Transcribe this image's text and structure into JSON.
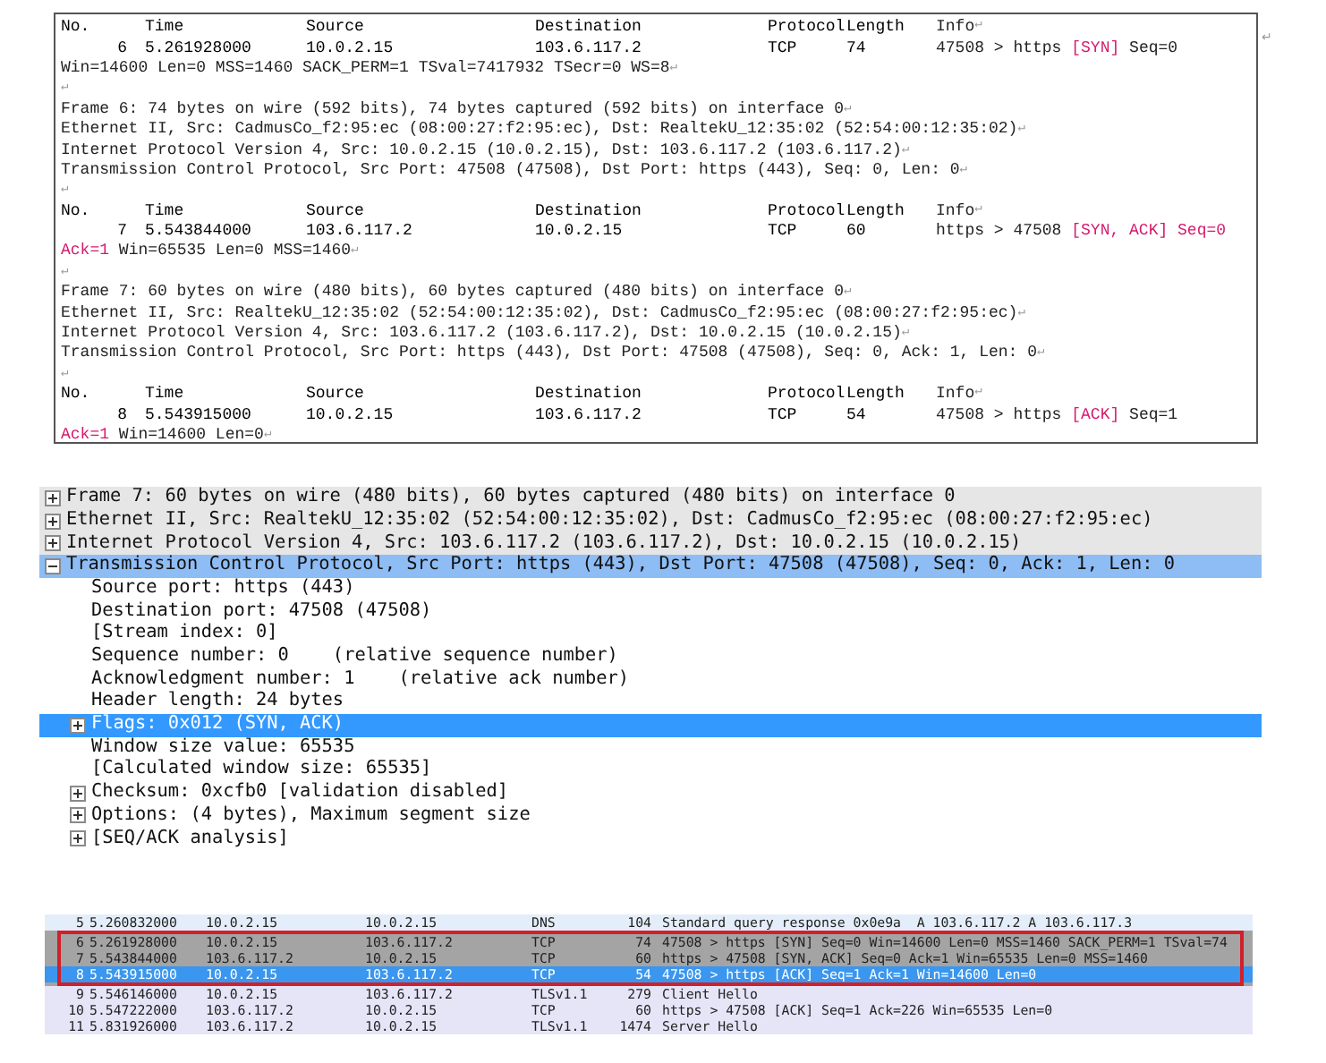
{
  "document": {
    "lines": [
      {
        "kind": "header",
        "cells": [
          "No.",
          "Time",
          "Source",
          "Destination",
          "Protocol",
          "Length"
        ],
        "info": [
          {
            "text": "Info",
            "kind": "plain"
          },
          {
            "text": "↵",
            "kind": "mark"
          }
        ]
      },
      {
        "kind": "packet",
        "cells": [
          "6",
          "5.261928000",
          "10.0.2.15",
          "103.6.117.2",
          "TCP",
          "74"
        ],
        "info": [
          {
            "text": "47508 > https ",
            "kind": "plain"
          },
          {
            "text": "[SYN]",
            "kind": "flag"
          },
          {
            "text": " Seq=0",
            "kind": "plain"
          }
        ]
      },
      {
        "kind": "text",
        "segments": [
          {
            "text": "Win=14600 Len=0 MSS=1460 SACK_PERM=1 TSval=7417932 TSecr=0 WS=8",
            "kind": "plain"
          },
          {
            "text": "↵",
            "kind": "mark"
          }
        ]
      },
      {
        "kind": "text",
        "segments": [
          {
            "text": "↵",
            "kind": "mark"
          }
        ]
      },
      {
        "kind": "text",
        "segments": [
          {
            "text": "Frame 6: 74 bytes on wire (592 bits), 74 bytes captured (592 bits) on interface 0",
            "kind": "plain"
          },
          {
            "text": "↵",
            "kind": "mark"
          }
        ]
      },
      {
        "kind": "text",
        "segments": [
          {
            "text": "Ethernet II, Src: CadmusCo_f2:95:ec (08:00:27:f2:95:ec), Dst: RealtekU_12:35:02 (52:54:00:12:35:02)",
            "kind": "plain"
          },
          {
            "text": "↵",
            "kind": "mark"
          }
        ]
      },
      {
        "kind": "text",
        "segments": [
          {
            "text": "Internet Protocol Version 4, Src: 10.0.2.15 (10.0.2.15), Dst: 103.6.117.2 (103.6.117.2)",
            "kind": "plain"
          },
          {
            "text": "↵",
            "kind": "mark"
          }
        ]
      },
      {
        "kind": "text",
        "segments": [
          {
            "text": "Transmission Control Protocol, Src Port: 47508 (47508), Dst Port: https (443), Seq: 0, Len: 0",
            "kind": "plain"
          },
          {
            "text": "↵",
            "kind": "mark"
          }
        ]
      },
      {
        "kind": "text",
        "segments": [
          {
            "text": "↵",
            "kind": "mark"
          }
        ]
      },
      {
        "kind": "header",
        "cells": [
          "No.",
          "Time",
          "Source",
          "Destination",
          "Protocol",
          "Length"
        ],
        "info": [
          {
            "text": "Info",
            "kind": "plain"
          },
          {
            "text": "↵",
            "kind": "mark"
          }
        ]
      },
      {
        "kind": "packet",
        "cells": [
          "7",
          "5.543844000",
          "103.6.117.2",
          "10.0.2.15",
          "TCP",
          "60"
        ],
        "info": [
          {
            "text": "https > 47508 ",
            "kind": "plain"
          },
          {
            "text": "[SYN, ACK] Seq=0",
            "kind": "flag"
          }
        ]
      },
      {
        "kind": "text",
        "segments": [
          {
            "text": "Ack=1",
            "kind": "flag"
          },
          {
            "text": " Win=65535 Len=0 MSS=1460",
            "kind": "plain"
          },
          {
            "text": "↵",
            "kind": "mark"
          }
        ]
      },
      {
        "kind": "text",
        "segments": [
          {
            "text": "↵",
            "kind": "mark"
          }
        ]
      },
      {
        "kind": "text",
        "segments": [
          {
            "text": "Frame 7: 60 bytes on wire (480 bits), 60 bytes captured (480 bits) on interface 0",
            "kind": "plain"
          },
          {
            "text": "↵",
            "kind": "mark"
          }
        ]
      },
      {
        "kind": "text",
        "segments": [
          {
            "text": "Ethernet II, Src: RealtekU_12:35:02 (52:54:00:12:35:02), Dst: CadmusCo_f2:95:ec (08:00:27:f2:95:ec)",
            "kind": "plain"
          },
          {
            "text": "↵",
            "kind": "mark"
          }
        ]
      },
      {
        "kind": "text",
        "segments": [
          {
            "text": "Internet Protocol Version 4, Src: 103.6.117.2 (103.6.117.2), Dst: 10.0.2.15 (10.0.2.15)",
            "kind": "plain"
          },
          {
            "text": "↵",
            "kind": "mark"
          }
        ]
      },
      {
        "kind": "text",
        "segments": [
          {
            "text": "Transmission Control Protocol, Src Port: https (443), Dst Port: 47508 (47508), Seq: 0, Ack: 1, Len: 0",
            "kind": "plain"
          },
          {
            "text": "↵",
            "kind": "mark"
          }
        ]
      },
      {
        "kind": "text",
        "segments": [
          {
            "text": "↵",
            "kind": "mark"
          }
        ]
      },
      {
        "kind": "header",
        "cells": [
          "No.",
          "Time",
          "Source",
          "Destination",
          "Protocol",
          "Length"
        ],
        "info": [
          {
            "text": "Info",
            "kind": "plain"
          },
          {
            "text": "↵",
            "kind": "mark"
          }
        ]
      },
      {
        "kind": "packet",
        "cells": [
          "8",
          "5.543915000",
          "10.0.2.15",
          "103.6.117.2",
          "TCP",
          "54"
        ],
        "info": [
          {
            "text": "47508 > https ",
            "kind": "plain"
          },
          {
            "text": "[ACK]",
            "kind": "flag"
          },
          {
            "text": " Seq=1",
            "kind": "plain"
          }
        ]
      },
      {
        "kind": "text",
        "segments": [
          {
            "text": "Ack=1",
            "kind": "flag"
          },
          {
            "text": " Win=14600 Len=0",
            "kind": "plain"
          },
          {
            "text": "↵",
            "kind": "mark"
          }
        ]
      }
    ],
    "trailing_mark": "↵"
  },
  "packet_details": [
    {
      "label": "Frame 7: 60 bytes on wire (480 bits), 60 bytes captured (480 bits) on interface 0",
      "expanded": false,
      "selected": false
    },
    {
      "label": "Ethernet II, Src: RealtekU_12:35:02 (52:54:00:12:35:02), Dst: CadmusCo_f2:95:ec (08:00:27:f2:95:ec)",
      "expanded": false,
      "selected": false
    },
    {
      "label": "Internet Protocol Version 4, Src: 103.6.117.2 (103.6.117.2), Dst: 10.0.2.15 (10.0.2.15)",
      "expanded": false,
      "selected": false
    },
    {
      "label": "Transmission Control Protocol, Src Port: https (443), Dst Port: 47508 (47508), Seq: 0, Ack: 1, Len: 0",
      "expanded": true,
      "selected": false,
      "children": [
        {
          "label": "Source port: https (443)",
          "selected": false
        },
        {
          "label": "Destination port: 47508 (47508)",
          "selected": false
        },
        {
          "label": "[Stream index: 0]",
          "selected": false
        },
        {
          "label": "Sequence number: 0    (relative sequence number)",
          "selected": false
        },
        {
          "label": "Acknowledgment number: 1    (relative ack number)",
          "selected": false
        },
        {
          "label": "Header length: 24 bytes",
          "selected": false
        },
        {
          "label": "Flags: 0x012 (SYN, ACK)",
          "expanded": false,
          "selected": true
        },
        {
          "label": "Window size value: 65535",
          "selected": false
        },
        {
          "label": "[Calculated window size: 65535]",
          "selected": false
        },
        {
          "label": "Checksum: 0xcfb0 [validation disabled]",
          "expanded": false,
          "selected": false
        },
        {
          "label": "Options: (4 bytes), Maximum segment size",
          "expanded": false,
          "selected": false
        },
        {
          "label": "[SEQ/ACK analysis]",
          "expanded": false,
          "selected": false
        }
      ]
    }
  ],
  "packet_list": [
    {
      "no": "5",
      "time": "5.260832000",
      "source": "10.0.2.15",
      "destination": "10.0.2.15",
      "protocol": "DNS",
      "length": "104",
      "info": "Standard query response 0x0e9a  A 103.6.117.2 A 103.6.117.3",
      "color": "#e4eefa",
      "selected": false,
      "boxed": false
    },
    {
      "no": "6",
      "time": "5.261928000",
      "source": "10.0.2.15",
      "destination": "103.6.117.2",
      "protocol": "TCP",
      "length": "74",
      "info": "47508 > https [SYN] Seq=0 Win=14600 Len=0 MSS=1460 SACK_PERM=1 TSval=74",
      "color": "#a4a4a4",
      "selected": false,
      "boxed": true
    },
    {
      "no": "7",
      "time": "5.543844000",
      "source": "103.6.117.2",
      "destination": "10.0.2.15",
      "protocol": "TCP",
      "length": "60",
      "info": "https > 47508 [SYN, ACK] Seq=0 Ack=1 Win=65535 Len=0 MSS=1460",
      "color": "#a4a4a4",
      "selected": false,
      "boxed": true
    },
    {
      "no": "8",
      "time": "5.543915000",
      "source": "10.0.2.15",
      "destination": "103.6.117.2",
      "protocol": "TCP",
      "length": "54",
      "info": "47508 > https [ACK] Seq=1 Ack=1 Win=14600 Len=0",
      "color": "#3a96ee",
      "selected": true,
      "boxed": true
    },
    {
      "no": "9",
      "time": "5.546146000",
      "source": "10.0.2.15",
      "destination": "103.6.117.2",
      "protocol": "TLSv1.1",
      "length": "279",
      "info": "Client Hello",
      "color": "#e6e5f8",
      "selected": false,
      "boxed": false
    },
    {
      "no": "10",
      "time": "5.547222000",
      "source": "103.6.117.2",
      "destination": "10.0.2.15",
      "protocol": "TCP",
      "length": "60",
      "info": "https > 47508 [ACK] Seq=1 Ack=226 Win=65535 Len=0",
      "color": "#e6e5f8",
      "selected": false,
      "boxed": false
    },
    {
      "no": "11",
      "time": "5.831926000",
      "source": "103.6.117.2",
      "destination": "10.0.2.15",
      "protocol": "TLSv1.1",
      "length": "1474",
      "info": "Server Hello",
      "color": "#e6e5f8",
      "selected": false,
      "boxed": false
    }
  ]
}
